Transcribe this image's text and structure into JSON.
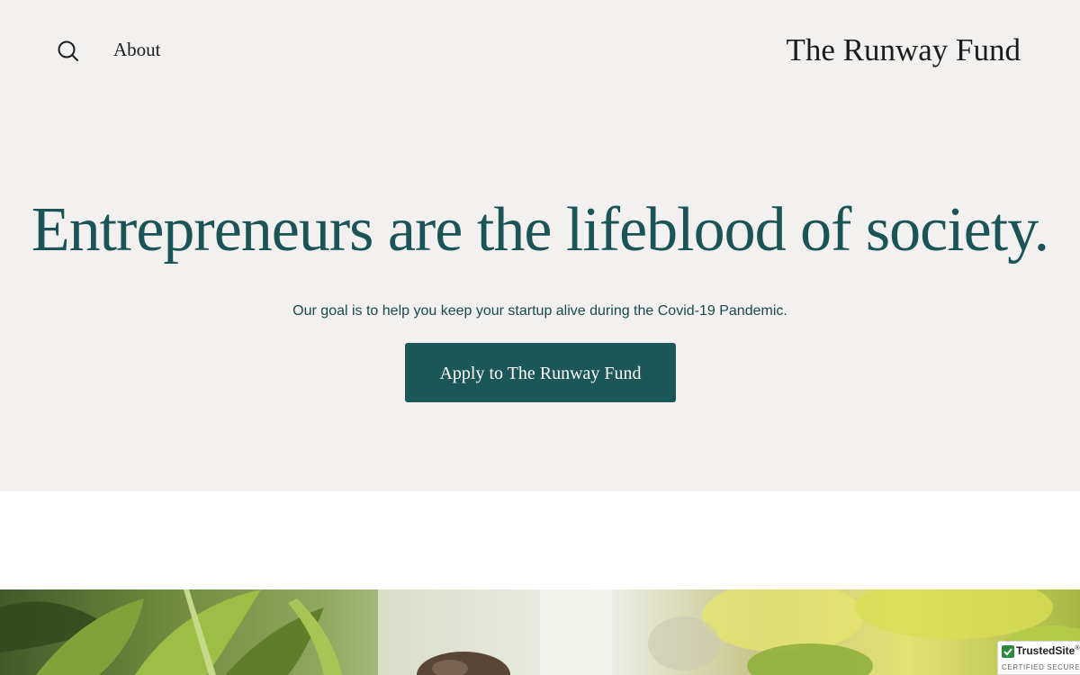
{
  "header": {
    "search_icon": "search-icon",
    "nav_about": "About",
    "site_title": "The Runway Fund"
  },
  "hero": {
    "headline": "Entrepreneurs are the lifeblood of society.",
    "subtitle": "Our goal is to help you keep your startup alive during the Covid-19 Pandemic.",
    "cta_label": "Apply to The Runway Fund"
  },
  "badge": {
    "name": "TrustedSite",
    "mark": "®",
    "sub": "CERTIFIED SECURE"
  },
  "colors": {
    "hero_bg": "#f3f1ef",
    "accent": "#1b5658",
    "headline": "#1a5456",
    "text_dark": "#1c1c1c"
  }
}
